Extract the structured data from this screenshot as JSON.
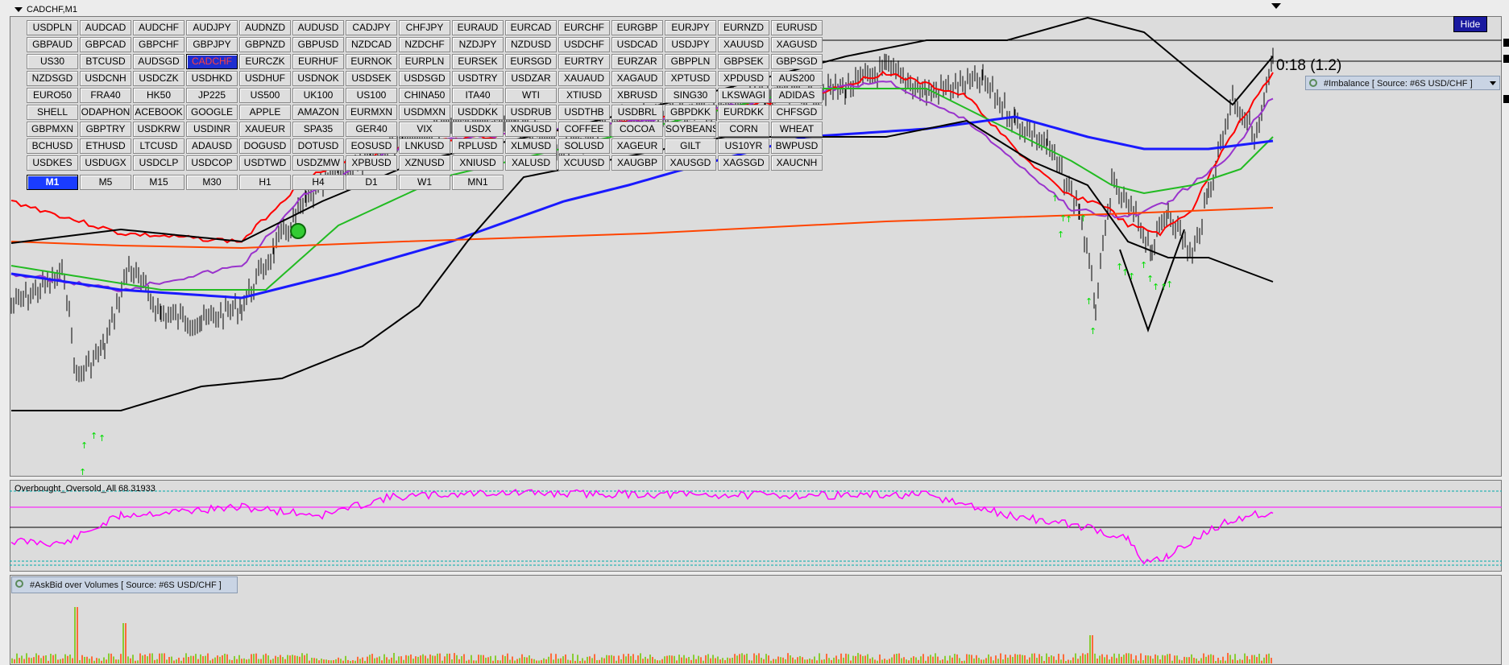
{
  "window": {
    "title": "CADCHF,M1"
  },
  "symbol_buttons": [
    [
      "USDPLN",
      "AUDCAD",
      "AUDCHF",
      "AUDJPY",
      "AUDNZD",
      "AUDUSD",
      "CADJPY",
      "CHFJPY",
      "EURAUD",
      "EURCAD",
      "EURCHF",
      "EURGBP",
      "EURJPY",
      "EURNZD",
      "EURUSD"
    ],
    [
      "GBPAUD",
      "GBPCAD",
      "GBPCHF",
      "GBPJPY",
      "GBPNZD",
      "GBPUSD",
      "NZDCAD",
      "NZDCHF",
      "NZDJPY",
      "NZDUSD",
      "USDCHF",
      "USDCAD",
      "USDJPY",
      "XAUUSD",
      "XAGUSD"
    ],
    [
      "US30",
      "BTCUSD",
      "AUDSGD",
      "CADCHF",
      "EURCZK",
      "EURHUF",
      "EURNOK",
      "EURPLN",
      "EURSEK",
      "EURSGD",
      "EURTRY",
      "EURZAR",
      "GBPPLN",
      "GBPSEK",
      "GBPSGD"
    ],
    [
      "NZDSGD",
      "USDCNH",
      "USDCZK",
      "USDHKD",
      "USDHUF",
      "USDNOK",
      "USDSEK",
      "USDSGD",
      "USDTRY",
      "USDZAR",
      "XAUAUD",
      "XAGAUD",
      "XPTUSD",
      "XPDUSD",
      "AUS200"
    ],
    [
      "EURO50",
      "FRA40",
      "HK50",
      "JP225",
      "US500",
      "UK100",
      "US100",
      "CHINA50",
      "ITA40",
      "WTI",
      "XTIUSD",
      "XBRUSD",
      "SING30",
      "LKSWAGI",
      "ADIDAS"
    ],
    [
      "SHELL",
      "ODAPHON",
      "ACEBOOK",
      "GOOGLE",
      "APPLE",
      "AMAZON",
      "EURMXN",
      "USDMXN",
      "USDDKK",
      "USDRUB",
      "USDTHB",
      "USDBRL",
      "GBPDKK",
      "EURDKK",
      "CHFSGD"
    ],
    [
      "GBPMXN",
      "GBPTRY",
      "USDKRW",
      "USDINR",
      "XAUEUR",
      "SPA35",
      "GER40",
      "VIX",
      "USDX",
      "XNGUSD",
      "COFFEE",
      "COCOA",
      "SOYBEANS",
      "CORN",
      "WHEAT"
    ],
    [
      "BCHUSD",
      "ETHUSD",
      "LTCUSD",
      "ADAUSD",
      "DOGUSD",
      "DOTUSD",
      "EOSUSD",
      "LNKUSD",
      "RPLUSD",
      "XLMUSD",
      "SOLUSD",
      "XAGEUR",
      "GILT",
      "US10YR",
      "BWPUSD"
    ],
    [
      "USDKES",
      "USDUGX",
      "USDCLP",
      "USDCOP",
      "USDTWD",
      "USDZMW",
      "XPBUSD",
      "XZNUSD",
      "XNIUSD",
      "XALUSD",
      "XCUUSD",
      "XAUGBP",
      "XAUSGD",
      "XAGSGD",
      "XAUCNH"
    ]
  ],
  "active_symbol": "CADCHF",
  "timeframes": [
    "M1",
    "M5",
    "M15",
    "M30",
    "H1",
    "H4",
    "D1",
    "W1",
    "MN1"
  ],
  "active_timeframe": "M1",
  "hide_label": "Hide",
  "countdown": "0:18 (1.2)",
  "imbalance_label": "#Imbalance [ Source: #6S USD/CHF ]",
  "oscillator_label": "Overbought_Oversold_All 68.31933",
  "volume_label": "#AskBid over Volumes [ Source: #6S USD/CHF ]",
  "colors": {
    "ema_fast": "#ff0000",
    "ema_mid": "#9933cc",
    "ema_slow": "#22bb22",
    "ma_long": "#1a1aff",
    "ma_very_long": "#ff4400",
    "bands": "#000000",
    "oscillator": "#ff00ff",
    "arrows": "#00dd00",
    "active_symbol_bg": "#1e2ed0",
    "active_tf_bg": "#1a3cff"
  }
}
